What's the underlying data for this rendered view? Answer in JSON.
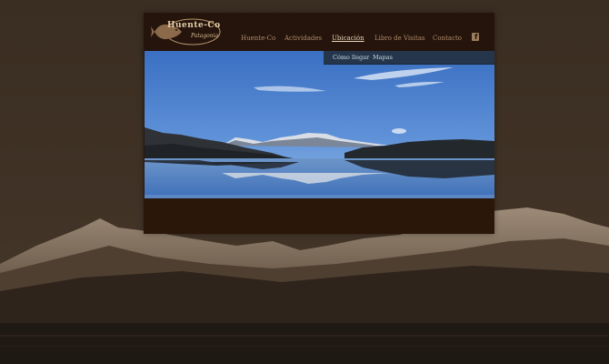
{
  "logo": {
    "name": "Huente-Co",
    "tagline": "Patagonia"
  },
  "nav": {
    "items": [
      {
        "label": "Huente-Co"
      },
      {
        "label": "Actividades"
      },
      {
        "label": "Ubicación",
        "active": true
      },
      {
        "label": "Libro de Visitas"
      },
      {
        "label": "Contacto"
      }
    ],
    "social_icon": "facebook-icon"
  },
  "submenu": {
    "items": [
      {
        "label": "Cómo llegar"
      },
      {
        "label": "Mapas"
      }
    ]
  },
  "colors": {
    "header_bg": "#24140c",
    "nav_text": "#b08a68",
    "nav_active": "#e9d6b6",
    "submenu_bg": "#25364c"
  }
}
